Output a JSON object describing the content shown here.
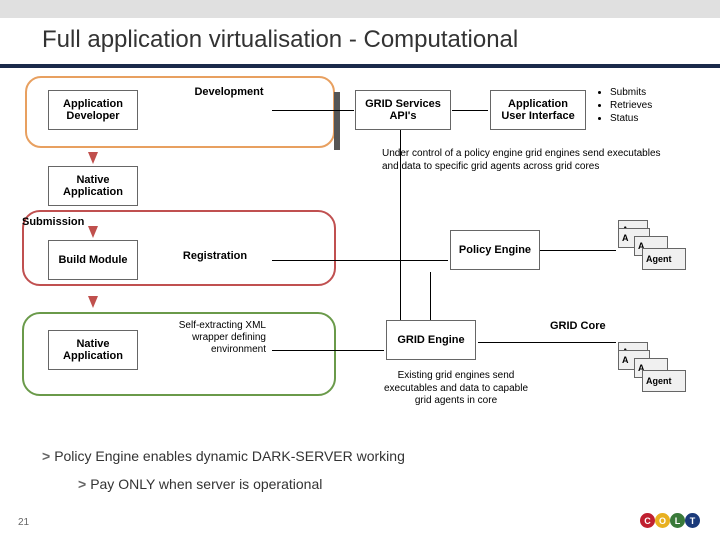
{
  "title": "Full application virtualisation - Computational",
  "labels": {
    "development": "Development",
    "submission": "Submission",
    "registration": "Registration",
    "selfextract": "Self-extracting XML wrapper defining environment",
    "gridcore": "GRID Core"
  },
  "boxes": {
    "app_dev": "Application Developer",
    "native_app1": "Native Application",
    "build_mod": "Build Module",
    "native_app2": "Native Application",
    "grid_svc": "GRID Services API's",
    "app_ui": "Application User Interface",
    "policy": "Policy Engine",
    "grid_engine": "GRID Engine",
    "agent": "Agent"
  },
  "notes": {
    "policy_note": "Under control of a policy engine grid engines send executables and data to specific grid agents across grid cores",
    "existing_note": "Existing grid engines send executables and data to capable grid agents in core"
  },
  "bullets": [
    "Submits",
    "Retrieves",
    "Status"
  ],
  "footer1": "Policy Engine enables dynamic DARK-SERVER working",
  "footer2": "Pay ONLY when server is operational",
  "pageno": "21",
  "logo": [
    "C",
    "O",
    "L",
    "T"
  ]
}
